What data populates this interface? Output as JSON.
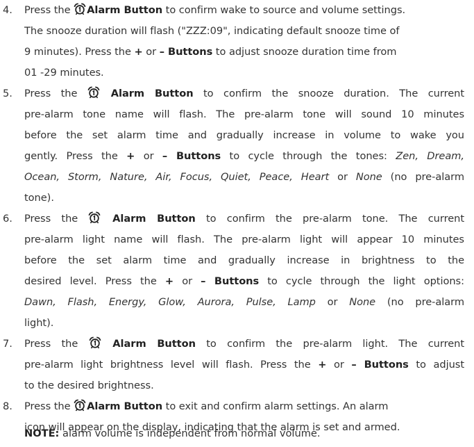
{
  "steps": [
    {
      "number": "4.",
      "segments": [
        {
          "t": "Press the ",
          "s": "plain"
        },
        {
          "t": "",
          "s": "icon"
        },
        {
          "t": "Alarm Button",
          "s": "bold"
        },
        {
          "t": " to confirm wake to source and volume settings.",
          "s": "plain"
        },
        {
          "t": "The snooze duration will flash (\"ZZZ:09\", indicating default snooze time of",
          "s": "plain"
        },
        {
          "t": "9 minutes). Press the ",
          "s": "plain"
        },
        {
          "t": "+",
          "s": "bold"
        },
        {
          "t": " or ",
          "s": "plain"
        },
        {
          "t": "– Buttons",
          "s": "bold"
        },
        {
          "t": " to adjust snooze duration time from",
          "s": "plain"
        },
        {
          "t": "01 -29 minutes.",
          "s": "plain"
        }
      ]
    },
    {
      "number": "5.",
      "segments": [
        {
          "t": "Press the ",
          "s": "plain"
        },
        {
          "t": "",
          "s": "icon"
        },
        {
          "t": " Alarm Button",
          "s": "bold"
        },
        {
          "t": " to confirm the snooze duration. The current",
          "s": "plain"
        },
        {
          "t": "pre-alarm tone name will flash. The pre-alarm tone will sound 10 minutes",
          "s": "plain"
        },
        {
          "t": "before the set alarm time and gradually increase in volume to wake you",
          "s": "plain"
        },
        {
          "t": "gently. Press the ",
          "s": "plain"
        },
        {
          "t": "+",
          "s": "bold"
        },
        {
          "t": " or ",
          "s": "plain"
        },
        {
          "t": "– Buttons",
          "s": "bold"
        },
        {
          "t": " to cycle through the tones: ",
          "s": "plain"
        },
        {
          "t": "Zen, Dream,",
          "s": "italic"
        },
        {
          "t": "Ocean, Storm, Nature, Air, Focus, Quiet, Peace, Heart",
          "s": "italic"
        },
        {
          "t": " or ",
          "s": "plain"
        },
        {
          "t": "None",
          "s": "italic"
        },
        {
          "t": " (no pre-alarm",
          "s": "plain"
        },
        {
          "t": "tone).",
          "s": "plain"
        }
      ]
    },
    {
      "number": "6.",
      "segments": [
        {
          "t": "Press the ",
          "s": "plain"
        },
        {
          "t": "",
          "s": "icon"
        },
        {
          "t": " Alarm Button",
          "s": "bold"
        },
        {
          "t": " to confirm the pre-alarm tone. The current",
          "s": "plain"
        },
        {
          "t": "pre-alarm light name will flash. The pre-alarm light will appear 10 minutes",
          "s": "plain"
        },
        {
          "t": "before the set alarm time and gradually increase in brightness to the",
          "s": "plain"
        },
        {
          "t": "desired level. Press the ",
          "s": "plain"
        },
        {
          "t": "+",
          "s": "bold"
        },
        {
          "t": " or ",
          "s": "plain"
        },
        {
          "t": "– Buttons",
          "s": "bold"
        },
        {
          "t": " to cycle through the light options:",
          "s": "plain"
        },
        {
          "t": "Dawn, Flash, Energy, Glow, Aurora, Pulse, Lamp",
          "s": "italic"
        },
        {
          "t": " or ",
          "s": "plain"
        },
        {
          "t": "None",
          "s": "italic"
        },
        {
          "t": " (no pre-alarm",
          "s": "plain"
        },
        {
          "t": "light).",
          "s": "plain"
        }
      ]
    },
    {
      "number": "7.",
      "segments": [
        {
          "t": "Press the ",
          "s": "plain"
        },
        {
          "t": "",
          "s": "icon"
        },
        {
          "t": " Alarm Button",
          "s": "bold"
        },
        {
          "t": " to confirm the pre-alarm light. The current",
          "s": "plain"
        },
        {
          "t": "pre-alarm light brightness level will flash. Press the ",
          "s": "plain"
        },
        {
          "t": "+",
          "s": "bold"
        },
        {
          "t": " or ",
          "s": "plain"
        },
        {
          "t": "– Buttons",
          "s": "bold"
        },
        {
          "t": " to adjust",
          "s": "plain"
        },
        {
          "t": "to the desired brightness.",
          "s": "plain"
        }
      ]
    },
    {
      "number": "8.",
      "segments": [
        {
          "t": "Press the ",
          "s": "plain"
        },
        {
          "t": "",
          "s": "icon"
        },
        {
          "t": "Alarm Button",
          "s": "bold"
        },
        {
          "t": " to exit and confirm alarm settings. An alarm",
          "s": "plain"
        },
        {
          "t": "icon will appear on the display, indicating that the alarm is set and armed.",
          "s": "plain"
        }
      ]
    }
  ],
  "note": {
    "label": "NOTE:",
    "text": " alarm volume is independent from normal volume."
  },
  "icon": "alarm-clock-1-icon",
  "colors": {
    "text": "#333333",
    "bold": "#222222",
    "background": "#ffffff"
  }
}
